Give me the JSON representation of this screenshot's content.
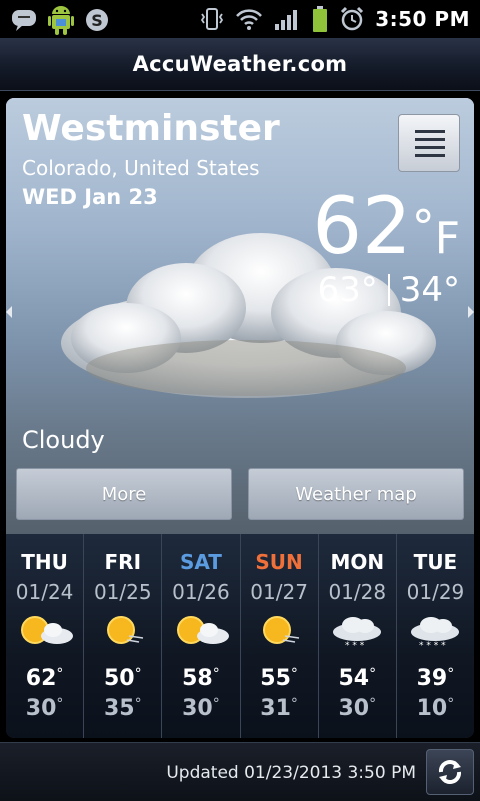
{
  "status_bar": {
    "time": "3:50 PM",
    "left_icons": [
      "messages-icon",
      "android-icon",
      "skype-icon"
    ],
    "right_icons": [
      "vibrate-icon",
      "wifi-icon",
      "signal-icon",
      "battery-icon",
      "alarm-icon"
    ]
  },
  "app": {
    "brand": "AccuWeather.com"
  },
  "current": {
    "city": "Westminster",
    "region": "Colorado, United States",
    "date": "WED Jan 23",
    "temp": "62",
    "temp_deg": "°",
    "unit": "F",
    "high": "63°",
    "low": "34°",
    "condition": "Cloudy"
  },
  "buttons": {
    "more": "More",
    "weather_map": "Weather map"
  },
  "forecast": [
    {
      "day": "THU",
      "date": "01/24",
      "high": "62",
      "low": "30",
      "icon": "partly-sunny-icon",
      "day_color": "#ffffff"
    },
    {
      "day": "FRI",
      "date": "01/25",
      "high": "50",
      "low": "35",
      "icon": "sunny-windy-icon",
      "day_color": "#ffffff"
    },
    {
      "day": "SAT",
      "date": "01/26",
      "high": "58",
      "low": "30",
      "icon": "partly-sunny-icon",
      "day_color": "#5b9be0"
    },
    {
      "day": "SUN",
      "date": "01/27",
      "high": "55",
      "low": "31",
      "icon": "sunny-windy-icon",
      "day_color": "#f0703a"
    },
    {
      "day": "MON",
      "date": "01/28",
      "high": "54",
      "low": "30",
      "icon": "cloudy-snow-icon",
      "day_color": "#ffffff"
    },
    {
      "day": "TUE",
      "date": "01/29",
      "high": "39",
      "low": "10",
      "icon": "snow-icon",
      "day_color": "#ffffff"
    }
  ],
  "footer": {
    "updated": "Updated 01/23/2013 3:50 PM"
  }
}
